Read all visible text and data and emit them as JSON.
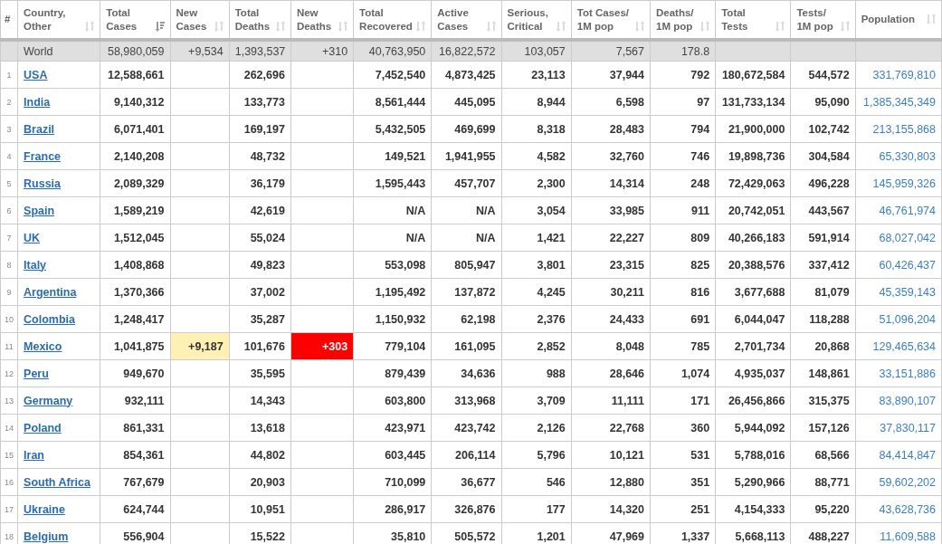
{
  "table": {
    "columns": [
      {
        "label": "#"
      },
      {
        "label": "Country,\nOther",
        "sorted": false
      },
      {
        "label": "Total\nCases",
        "sorted": true
      },
      {
        "label": "New\nCases",
        "sorted": false
      },
      {
        "label": "Total\nDeaths",
        "sorted": false
      },
      {
        "label": "New\nDeaths",
        "sorted": false
      },
      {
        "label": "Total\nRecovered",
        "sorted": false
      },
      {
        "label": "Active\nCases",
        "sorted": false
      },
      {
        "label": "Serious,\nCritical",
        "sorted": false
      },
      {
        "label": "Tot Cases/\n1M pop",
        "sorted": false
      },
      {
        "label": "Deaths/\n1M pop",
        "sorted": false
      },
      {
        "label": "Total\nTests",
        "sorted": false
      },
      {
        "label": "Tests/\n1M pop",
        "sorted": false
      },
      {
        "label": "Population",
        "sorted": false
      }
    ],
    "total_row": {
      "country": "World",
      "total_cases": "58,980,059",
      "new_cases": "+9,534",
      "total_deaths": "1,393,537",
      "new_deaths": "+310",
      "total_recovered": "40,763,950",
      "active_cases": "16,822,572",
      "serious_critical": "103,057",
      "tot_cases_per_1m": "7,567",
      "deaths_per_1m": "178.8"
    },
    "rows": [
      {
        "rank": "1",
        "country": "USA",
        "total_cases": "12,588,661",
        "total_deaths": "262,696",
        "total_recovered": "7,452,540",
        "active_cases": "4,873,425",
        "serious_critical": "23,113",
        "tot_cases_per_1m": "37,944",
        "deaths_per_1m": "792",
        "total_tests": "180,672,584",
        "tests_per_1m": "544,572",
        "population": "331,769,810"
      },
      {
        "rank": "2",
        "country": "India",
        "total_cases": "9,140,312",
        "total_deaths": "133,773",
        "total_recovered": "8,561,444",
        "active_cases": "445,095",
        "serious_critical": "8,944",
        "tot_cases_per_1m": "6,598",
        "deaths_per_1m": "97",
        "total_tests": "131,733,134",
        "tests_per_1m": "95,090",
        "population": "1,385,345,349"
      },
      {
        "rank": "3",
        "country": "Brazil",
        "total_cases": "6,071,401",
        "total_deaths": "169,197",
        "total_recovered": "5,432,505",
        "active_cases": "469,699",
        "serious_critical": "8,318",
        "tot_cases_per_1m": "28,483",
        "deaths_per_1m": "794",
        "total_tests": "21,900,000",
        "tests_per_1m": "102,742",
        "population": "213,155,868"
      },
      {
        "rank": "4",
        "country": "France",
        "total_cases": "2,140,208",
        "total_deaths": "48,732",
        "total_recovered": "149,521",
        "active_cases": "1,941,955",
        "serious_critical": "4,582",
        "tot_cases_per_1m": "32,760",
        "deaths_per_1m": "746",
        "total_tests": "19,898,736",
        "tests_per_1m": "304,584",
        "population": "65,330,803"
      },
      {
        "rank": "5",
        "country": "Russia",
        "total_cases": "2,089,329",
        "total_deaths": "36,179",
        "total_recovered": "1,595,443",
        "active_cases": "457,707",
        "serious_critical": "2,300",
        "tot_cases_per_1m": "14,314",
        "deaths_per_1m": "248",
        "total_tests": "72,429,063",
        "tests_per_1m": "496,228",
        "population": "145,959,326"
      },
      {
        "rank": "6",
        "country": "Spain",
        "total_cases": "1,589,219",
        "total_deaths": "42,619",
        "total_recovered": "N/A",
        "active_cases": "N/A",
        "serious_critical": "3,054",
        "tot_cases_per_1m": "33,985",
        "deaths_per_1m": "911",
        "total_tests": "20,742,051",
        "tests_per_1m": "443,567",
        "population": "46,761,974"
      },
      {
        "rank": "7",
        "country": "UK",
        "total_cases": "1,512,045",
        "total_deaths": "55,024",
        "total_recovered": "N/A",
        "active_cases": "N/A",
        "serious_critical": "1,421",
        "tot_cases_per_1m": "22,227",
        "deaths_per_1m": "809",
        "total_tests": "40,266,183",
        "tests_per_1m": "591,914",
        "population": "68,027,042"
      },
      {
        "rank": "8",
        "country": "Italy",
        "total_cases": "1,408,868",
        "total_deaths": "49,823",
        "total_recovered": "553,098",
        "active_cases": "805,947",
        "serious_critical": "3,801",
        "tot_cases_per_1m": "23,315",
        "deaths_per_1m": "825",
        "total_tests": "20,388,576",
        "tests_per_1m": "337,412",
        "population": "60,426,437"
      },
      {
        "rank": "9",
        "country": "Argentina",
        "total_cases": "1,370,366",
        "total_deaths": "37,002",
        "total_recovered": "1,195,492",
        "active_cases": "137,872",
        "serious_critical": "4,245",
        "tot_cases_per_1m": "30,211",
        "deaths_per_1m": "816",
        "total_tests": "3,677,688",
        "tests_per_1m": "81,079",
        "population": "45,359,143"
      },
      {
        "rank": "10",
        "country": "Colombia",
        "total_cases": "1,248,417",
        "total_deaths": "35,287",
        "total_recovered": "1,150,932",
        "active_cases": "62,198",
        "serious_critical": "2,376",
        "tot_cases_per_1m": "24,433",
        "deaths_per_1m": "691",
        "total_tests": "6,044,047",
        "tests_per_1m": "118,288",
        "population": "51,096,204"
      },
      {
        "rank": "11",
        "country": "Mexico",
        "total_cases": "1,041,875",
        "new_cases": "+9,187",
        "total_deaths": "101,676",
        "new_deaths": "+303",
        "total_recovered": "779,104",
        "active_cases": "161,095",
        "serious_critical": "2,852",
        "tot_cases_per_1m": "8,048",
        "deaths_per_1m": "785",
        "total_tests": "2,701,734",
        "tests_per_1m": "20,868",
        "population": "129,465,634"
      },
      {
        "rank": "12",
        "country": "Peru",
        "total_cases": "949,670",
        "total_deaths": "35,595",
        "total_recovered": "879,439",
        "active_cases": "34,636",
        "serious_critical": "988",
        "tot_cases_per_1m": "28,646",
        "deaths_per_1m": "1,074",
        "total_tests": "4,935,037",
        "tests_per_1m": "148,861",
        "population": "33,151,886"
      },
      {
        "rank": "13",
        "country": "Germany",
        "total_cases": "932,111",
        "total_deaths": "14,343",
        "total_recovered": "603,800",
        "active_cases": "313,968",
        "serious_critical": "3,709",
        "tot_cases_per_1m": "11,111",
        "deaths_per_1m": "171",
        "total_tests": "26,456,866",
        "tests_per_1m": "315,375",
        "population": "83,890,107"
      },
      {
        "rank": "14",
        "country": "Poland",
        "total_cases": "861,331",
        "total_deaths": "13,618",
        "total_recovered": "423,971",
        "active_cases": "423,742",
        "serious_critical": "2,126",
        "tot_cases_per_1m": "22,768",
        "deaths_per_1m": "360",
        "total_tests": "5,944,092",
        "tests_per_1m": "157,126",
        "population": "37,830,117"
      },
      {
        "rank": "15",
        "country": "Iran",
        "total_cases": "854,361",
        "total_deaths": "44,802",
        "total_recovered": "603,445",
        "active_cases": "206,114",
        "serious_critical": "5,796",
        "tot_cases_per_1m": "10,121",
        "deaths_per_1m": "531",
        "total_tests": "5,788,016",
        "tests_per_1m": "68,566",
        "population": "84,414,847"
      },
      {
        "rank": "16",
        "country": "South Africa",
        "total_cases": "767,679",
        "total_deaths": "20,903",
        "total_recovered": "710,099",
        "active_cases": "36,677",
        "serious_critical": "546",
        "tot_cases_per_1m": "12,880",
        "deaths_per_1m": "351",
        "total_tests": "5,290,966",
        "tests_per_1m": "88,771",
        "population": "59,602,202"
      },
      {
        "rank": "17",
        "country": "Ukraine",
        "total_cases": "624,744",
        "total_deaths": "10,951",
        "total_recovered": "286,917",
        "active_cases": "326,876",
        "serious_critical": "177",
        "tot_cases_per_1m": "14,320",
        "deaths_per_1m": "251",
        "total_tests": "4,154,333",
        "tests_per_1m": "95,220",
        "population": "43,628,736"
      },
      {
        "rank": "18",
        "country": "Belgium",
        "total_cases": "556,904",
        "total_deaths": "15,522",
        "total_recovered": "35,810",
        "active_cases": "505,572",
        "serious_critical": "1,201",
        "tot_cases_per_1m": "47,969",
        "deaths_per_1m": "1,337",
        "total_tests": "5,668,113",
        "tests_per_1m": "488,227",
        "population": "11,609,588"
      }
    ]
  }
}
